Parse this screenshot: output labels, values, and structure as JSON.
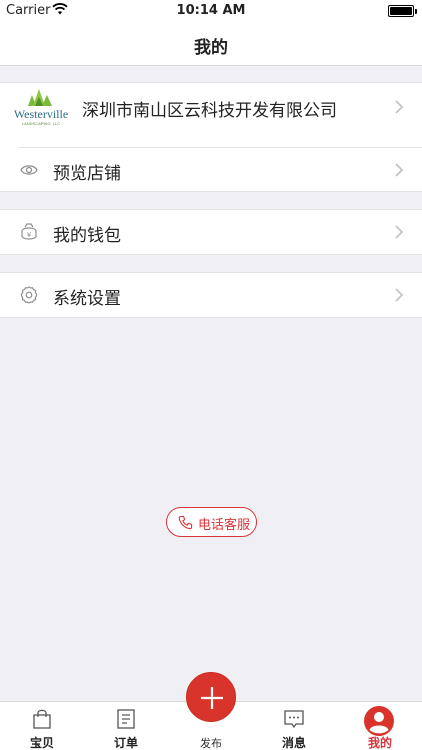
{
  "status_bar": {
    "carrier": "Carrier",
    "time": "10:14 AM"
  },
  "nav": {
    "title": "我的"
  },
  "company": {
    "logo_text": "Westerville",
    "logo_subtext": "LANDSCAPING, LLC",
    "name": "深圳市南山区云科技开发有限公司"
  },
  "menu": {
    "preview_store": "预览店铺",
    "wallet": "我的钱包",
    "settings": "系统设置"
  },
  "phone_service": {
    "label": "电话客服"
  },
  "tabs": {
    "baby": "宝贝",
    "orders": "订单",
    "publish": "发布",
    "messages": "消息",
    "mine": "我的"
  },
  "colors": {
    "accent": "#d9343a",
    "background": "#efeff4"
  }
}
